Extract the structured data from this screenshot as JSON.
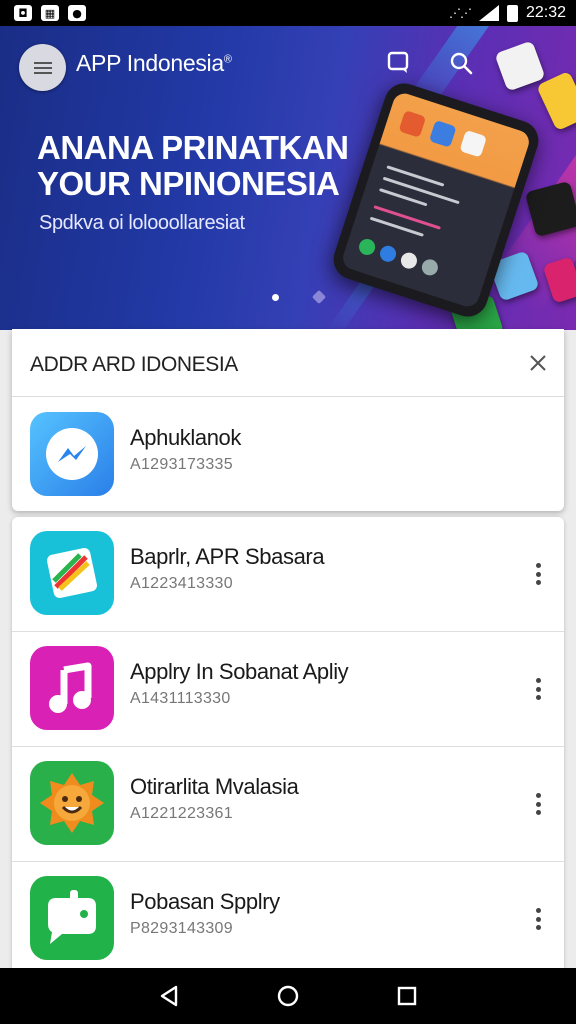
{
  "status_bar": {
    "time": "22:32",
    "left_icons": [
      "notification-icon",
      "gallery-icon",
      "message-icon"
    ],
    "right_icons": [
      "wifi-icon",
      "signal-icon",
      "battery-icon"
    ]
  },
  "header": {
    "title": "APP Indonesia",
    "title_mark": "®",
    "icons": [
      "menu-icon",
      "chat-icon",
      "search-icon"
    ]
  },
  "banner": {
    "headline_line1": "ANANA PRINATKAN",
    "headline_line2": "YOUR NPINONESIA",
    "subtitle": "Spdkva oi lolooollaresiat",
    "carousel_pages": 2,
    "active_page": 1
  },
  "panel": {
    "title": "ADDR ARD IDONESIA",
    "item": {
      "name": "Aphuklanok",
      "id": "A1293173335",
      "icon": "messenger-icon",
      "icon_color": "#3aa0f0"
    }
  },
  "apps": [
    {
      "name": "Baprlr, APR Sbasara",
      "id": "A1223413330",
      "icon": "design-icon",
      "icon_color": "#19c1d8"
    },
    {
      "name": "Applry In Sobanat Apliy",
      "id": "A1431113330",
      "icon": "music-note-icon",
      "icon_color": "#d921b5"
    },
    {
      "name": "Otirarlita Mvalasia",
      "id": "A1221223361",
      "icon": "sun-face-icon",
      "icon_color": "#2ab04a"
    },
    {
      "name": "Pobasan Spplry",
      "id": "P8293143309",
      "icon": "chat-bot-icon",
      "icon_color": "#22b24a"
    }
  ],
  "nav_bar": {
    "icons": [
      "back-icon",
      "home-icon",
      "recents-icon"
    ]
  },
  "colors": {
    "accent": "#2239a6",
    "banner_purple": "#7a2ab0"
  }
}
